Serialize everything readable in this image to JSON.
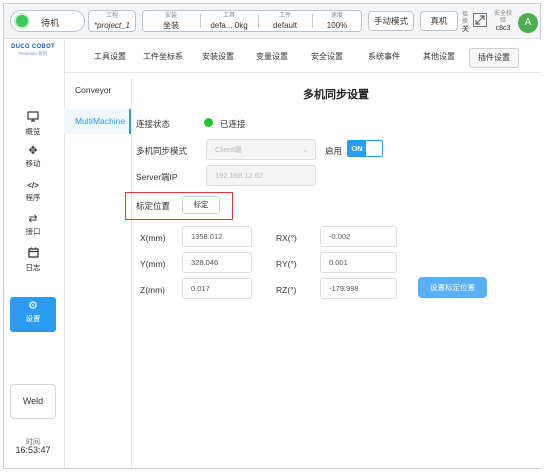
{
  "topbar": {
    "status": "待机",
    "project_label": "工程",
    "project_value": "*project_1",
    "install_label": "安装",
    "install_value": "坐装",
    "tool_label": "工具",
    "tool_value": "defa... 0kg",
    "workpiece_label": "工件",
    "workpiece_value": "default",
    "speed_label": "速度",
    "speed_value": "100%",
    "mode_button": "手动模式",
    "real_button": "真机",
    "side_text_1": "摇",
    "side_text_2": "换",
    "side_text_3": "关",
    "safety_label": "安全校验",
    "safety_code": "c8c3",
    "avatar": "A"
  },
  "logo": {
    "main": "DUCO COBOT",
    "sub": "Premium 系列"
  },
  "sidebar": {
    "items": [
      {
        "label": "概览",
        "icon": "monitor-icon"
      },
      {
        "label": "移动",
        "icon": "move-icon"
      },
      {
        "label": "程序",
        "icon": "code-icon"
      },
      {
        "label": "接口",
        "icon": "swap-icon"
      },
      {
        "label": "日志",
        "icon": "calendar-icon"
      },
      {
        "label": "设置",
        "icon": "gear-icon"
      }
    ],
    "active": "设置",
    "accent": "#2b9cf2"
  },
  "weld": "Weld",
  "clock": {
    "label": "时间",
    "time": "16:53:47"
  },
  "tabs": [
    "工具设置",
    "工件坐标系",
    "安装设置",
    "变量设置",
    "安全设置",
    "系统事件",
    "其他设置",
    "插件设置"
  ],
  "active_tab": "插件设置",
  "plugins": [
    "Conveyor",
    "MultiMachine"
  ],
  "active_plugin": "MultiMachine",
  "page": {
    "title": "多机同步设置",
    "conn_label": "连接状态",
    "conn_value": "已连接",
    "mode_label": "多机同步模式",
    "mode_value": "Client端",
    "enable_label": "启用",
    "enable_value": "ON",
    "server_label": "Server端IP",
    "server_value": "192.168.12.62",
    "calib_label": "标定位置",
    "calib_button": "标定",
    "x_label": "X(mm)",
    "x_value": "1358.012",
    "y_label": "Y(mm)",
    "y_value": "328.046",
    "z_label": "Z(mm)",
    "z_value": "0.017",
    "rx_label": "RX(°)",
    "rx_value": "-0.002",
    "ry_label": "RY(°)",
    "ry_value": "0.001",
    "rz_label": "RZ(°)",
    "rz_value": "-179.998",
    "set_button": "设置标定位置"
  }
}
